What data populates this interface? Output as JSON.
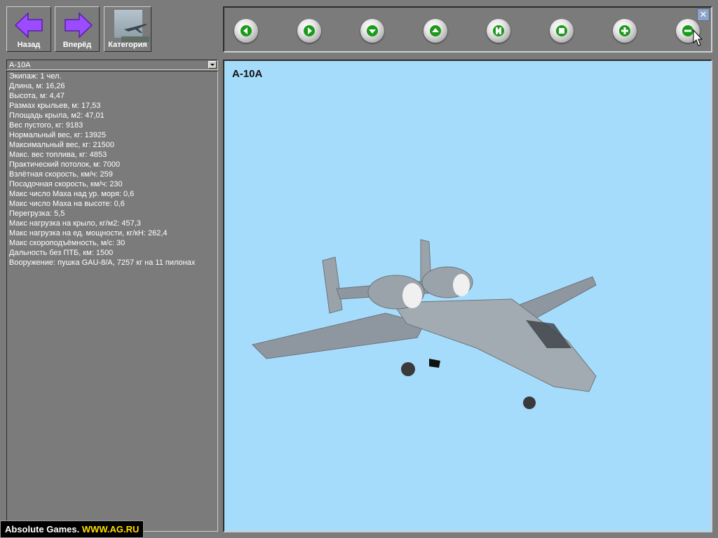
{
  "nav": {
    "back_label": "Назад",
    "forward_label": "Вперёд",
    "category_label": "Категория"
  },
  "toolbar": {
    "buttons": [
      {
        "icon": "rotate-left-icon"
      },
      {
        "icon": "rotate-right-icon"
      },
      {
        "icon": "rotate-down-icon"
      },
      {
        "icon": "rotate-up-icon"
      },
      {
        "icon": "reset-view-icon"
      },
      {
        "icon": "stop-icon"
      },
      {
        "icon": "zoom-in-icon"
      },
      {
        "icon": "zoom-out-icon"
      }
    ],
    "close_symbol": "✕"
  },
  "selector": {
    "value": "A-10A"
  },
  "specs": [
    "Экипаж: 1 чел.",
    "Длина, м: 16,26",
    "Высота, м: 4,47",
    "Размах крыльев, м: 17,53",
    "Площадь крыла, м2: 47,01",
    "Вес пустого, кг:  9183",
    "Нормальный вес, кг: 13925",
    "Максимальный вес, кг: 21500",
    "Макс. вес топлива, кг: 4853",
    "Практический потолок, м: 7000",
    "Взлётная скорость, км/ч: 259",
    "Посадочная скорость, км/ч: 230",
    "Макс число Маха над ур. моря:  0,6",
    "Макс число Маха на высоте: 0,6",
    "Перегрузка: 5,5",
    "Макс нагрузка на крыло, кг/м2: 457,3",
    "Макс нагрузка на ед. мощности, кг/кН: 262,4",
    "Макс скороподъёмность, м/с: 30",
    "Дальность без ПТБ, км: 1500",
    "Вооружение: пушка GAU-8/A, 7257 кг на 11 пилонах"
  ],
  "viewer": {
    "title": "A-10A"
  },
  "watermark": {
    "text1": "Absolute Games.",
    "text2": "WWW.AG.RU"
  },
  "colors": {
    "panel": "#7b7b7b",
    "sky": "#a6dcfb",
    "arrow": "#9b4cff",
    "button_icon": "#1a9a1a"
  }
}
